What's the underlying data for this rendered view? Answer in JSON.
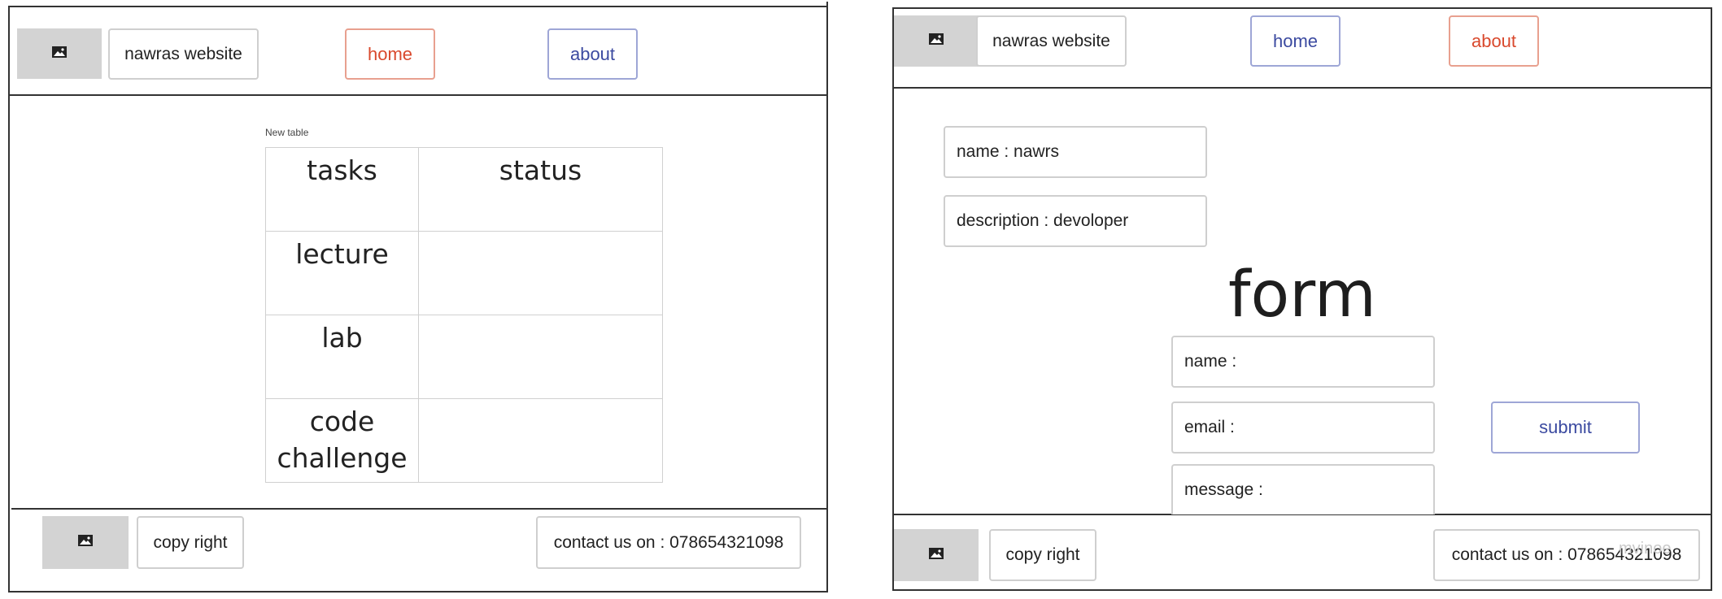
{
  "left_screen": {
    "header": {
      "logo_icon": "image-icon",
      "site_title": "nawras website",
      "nav_home": "home",
      "nav_about": "about"
    },
    "table": {
      "caption": "New table",
      "headers": [
        "tasks",
        "status"
      ],
      "rows": [
        [
          "lecture",
          ""
        ],
        [
          "lab",
          ""
        ],
        [
          "code challenge",
          ""
        ]
      ]
    },
    "footer": {
      "logo_icon": "image-icon",
      "copyright": "copy right",
      "contact": "contact us on : 078654321098"
    }
  },
  "right_screen": {
    "header": {
      "logo_icon": "image-icon",
      "site_title": "nawras website",
      "nav_home": "home",
      "nav_about": "about"
    },
    "profile": {
      "name": "name : nawrs",
      "description": "description : devoloper"
    },
    "form": {
      "title": "form",
      "name_field": "name :",
      "email_field": "email :",
      "message_field": "message :",
      "submit_label": "submit"
    },
    "footer": {
      "logo_icon": "image-icon",
      "copyright": "copy right",
      "contact": "contact us on : 078654321098"
    },
    "watermark": "mvinoe"
  },
  "colors": {
    "active_nav": "#d9492d",
    "inactive_nav": "#3b4aa0",
    "image_placeholder": "#d3d3d3",
    "frame": "#333333"
  }
}
